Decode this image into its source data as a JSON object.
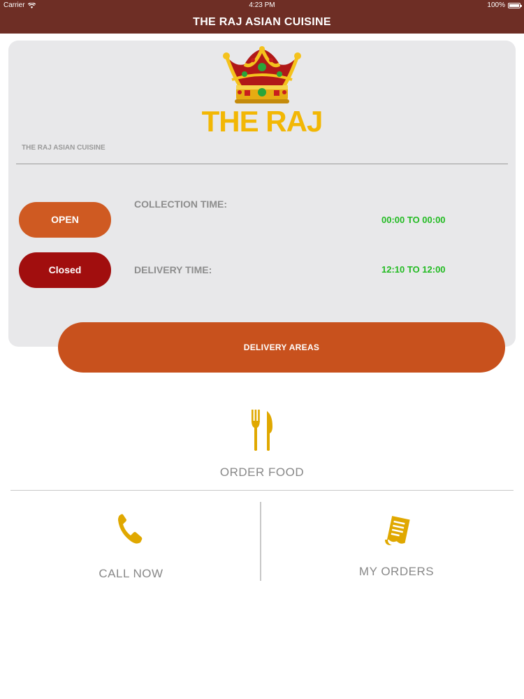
{
  "status_bar": {
    "carrier": "Carrier",
    "time": "4:23 PM",
    "battery": "100%",
    "wifi_icon": "wifi-icon",
    "battery_icon": "battery-icon"
  },
  "nav": {
    "title": "THE RAJ ASIAN CUISINE"
  },
  "restaurant": {
    "logo_icon": "crown-icon",
    "brand": "THE RAJ",
    "subtitle": "THE RAJ ASIAN CUISINE"
  },
  "hours": {
    "collection": {
      "status": "OPEN",
      "label": "COLLECTION TIME:",
      "value": "00:00 TO 00:00"
    },
    "delivery": {
      "status": "Closed",
      "label": "DELIVERY TIME:",
      "value": "12:10 TO 12:00"
    }
  },
  "delivery_areas": {
    "label": "DELIVERY AREAS"
  },
  "menu": {
    "order_food": {
      "label": "ORDER FOOD",
      "icon": "fork-knife-icon"
    },
    "call_now": {
      "label": "CALL NOW",
      "icon": "phone-icon"
    },
    "my_orders": {
      "label": "MY ORDERS",
      "icon": "receipt-icon"
    }
  },
  "colors": {
    "header": "#6e2e25",
    "open": "#cf5a22",
    "closed": "#a10e0e",
    "accent_orange": "#c8511d",
    "brand_gold": "#f2b705",
    "time_green": "#22bb22",
    "icon_gold": "#e0a800"
  }
}
